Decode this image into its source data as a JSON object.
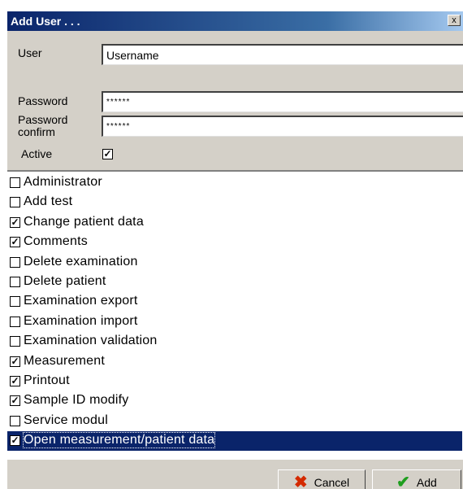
{
  "window": {
    "title": "Add User . . .",
    "close_glyph": "x"
  },
  "form": {
    "user_label": "User",
    "user_value": "Username",
    "password_label": "Password",
    "password_value": "******",
    "password_confirm_label": "Password confirm",
    "password_confirm_value": "******",
    "active_label": "Active",
    "active_checked": true
  },
  "permissions": [
    {
      "label": "Administrator",
      "checked": false,
      "selected": false
    },
    {
      "label": "Add test",
      "checked": false,
      "selected": false
    },
    {
      "label": "Change patient data",
      "checked": true,
      "selected": false
    },
    {
      "label": "Comments",
      "checked": true,
      "selected": false
    },
    {
      "label": "Delete examination",
      "checked": false,
      "selected": false
    },
    {
      "label": "Delete patient",
      "checked": false,
      "selected": false
    },
    {
      "label": "Examination export",
      "checked": false,
      "selected": false
    },
    {
      "label": "Examination import",
      "checked": false,
      "selected": false
    },
    {
      "label": "Examination validation",
      "checked": false,
      "selected": false
    },
    {
      "label": "Measurement",
      "checked": true,
      "selected": false
    },
    {
      "label": "Printout",
      "checked": true,
      "selected": false
    },
    {
      "label": "Sample ID modify",
      "checked": true,
      "selected": false
    },
    {
      "label": "Service modul",
      "checked": false,
      "selected": false
    },
    {
      "label": "Open measurement/patient data",
      "checked": true,
      "selected": true
    }
  ],
  "buttons": {
    "cancel_label": "Cancel",
    "add_label": "Add"
  },
  "icons": {
    "cancel": "cancel-x-icon",
    "add": "checkmark-icon"
  },
  "colors": {
    "titlebar": "#0a246a",
    "dialog_bg": "#d4d0c8",
    "selection": "#0a246a",
    "cancel_icon": "#d42a00",
    "add_icon": "#1e9e1e"
  }
}
